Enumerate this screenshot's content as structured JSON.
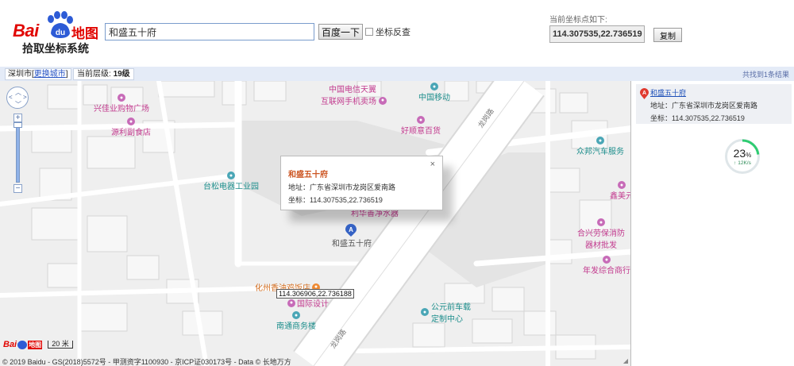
{
  "header": {
    "logo": {
      "word": "Bai",
      "paw_text": "du",
      "map_text": "地图",
      "subtitle": "拾取坐标系统"
    },
    "search": {
      "value": "和盛五十府",
      "button_label": "百度一下",
      "reverse_label": "坐标反查",
      "reverse_checked": false
    },
    "coords": {
      "label": "当前坐标点如下:",
      "value": "114.307535,22.736519",
      "copy_label": "复制"
    }
  },
  "status_bar": {
    "city": "深圳市",
    "change_city_label": "更换城市",
    "zoom_prefix": "当前层级:",
    "zoom_level": "19级",
    "result_count": "共找到1条结果"
  },
  "map": {
    "pois": [
      {
        "name": "兴佳业购物广场",
        "color": "pink"
      },
      {
        "name": "源利副食店",
        "color": "pink"
      },
      {
        "name": "中国电信天翼",
        "color": "pink"
      },
      {
        "name": "互联网手机卖场",
        "color": "pink"
      },
      {
        "name": "中国移动",
        "color": "teal"
      },
      {
        "name": "好顺意百货",
        "color": "pink"
      },
      {
        "name": "台松电器工业园",
        "color": "teal"
      },
      {
        "name": "众邦汽车服务",
        "color": "teal"
      },
      {
        "name": "鑫美元",
        "color": "pink"
      },
      {
        "name": "合兴劳保消防",
        "color": "pink"
      },
      {
        "name": "器材批发",
        "color": "pink"
      },
      {
        "name": "年发综合商行",
        "color": "pink"
      },
      {
        "name": "化州香油鸡饭店",
        "color": "orange"
      },
      {
        "name": "国际设计",
        "color": "pink"
      },
      {
        "name": "南通商务楼",
        "color": "teal"
      },
      {
        "name": "公元前车载",
        "color": "teal"
      },
      {
        "name": "定制中心",
        "color": "teal"
      },
      {
        "name": "利华善净水器",
        "color": "pink"
      }
    ],
    "road_labels": [
      "龙岗路",
      "龙岗路"
    ],
    "marker": {
      "letter": "A",
      "label": "和盛五十府"
    },
    "info_window": {
      "title": "和盛五十府",
      "address": "地址：广东省深圳市龙岗区爱南路",
      "coords": "坐标：114.307535,22.736519",
      "close": "×"
    },
    "cursor_coords": "114.306906,22.736188",
    "scale": "20 米",
    "mini_logo": {
      "word": "Bai",
      "map_text": "地图"
    },
    "copyright": "© 2019 Baidu - GS(2018)5572号 - 甲测资字1100930 - 京ICP证030173号 - Data © 长地万方",
    "nav_icons": [
      "pan-icon",
      "zoom-in-icon",
      "zoom-out-icon"
    ]
  },
  "results": {
    "item": {
      "letter": "A",
      "name": "和盛五十府",
      "address": "地址：广东省深圳市龙岗区爱南路",
      "coords": "坐标：114.307535,22.736519"
    }
  },
  "speed_widget": {
    "percent": "23",
    "percent_unit": "%",
    "rate": "↑ 12K/s",
    "accent": "#2ecc71"
  },
  "colors": {
    "brand_red": "#e10602",
    "brand_blue": "#2d5bd6",
    "link_blue": "#1c4fb8",
    "info_title": "#cc5522",
    "map_bg": "#efefef",
    "road": "#ffffff"
  }
}
